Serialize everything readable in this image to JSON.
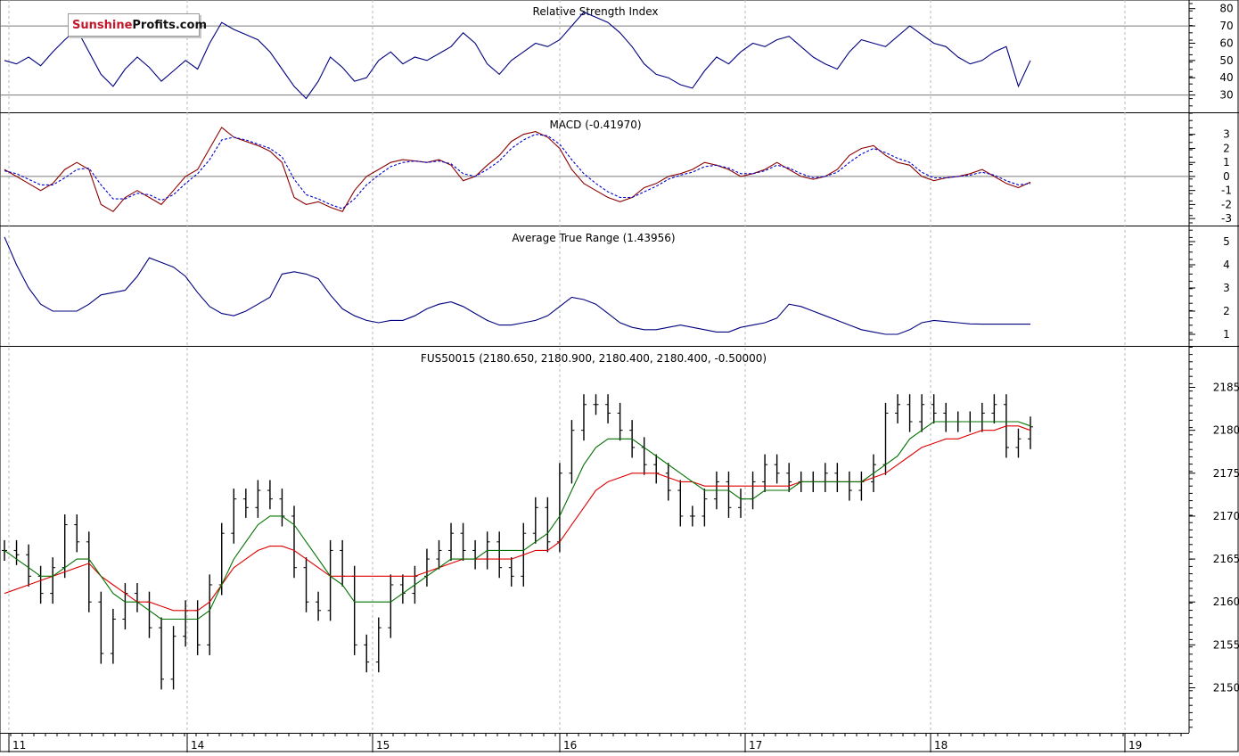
{
  "logo": {
    "part1": "Sunshine",
    "part2": "Profits.com"
  },
  "panels": {
    "rsi": {
      "title": "Relative Strength Index",
      "ticks": [
        "80",
        "70",
        "60",
        "50",
        "40",
        "30"
      ],
      "levels": [
        70,
        30
      ]
    },
    "macd": {
      "title": "MACD (-0.41970)",
      "ticks": [
        "3",
        "2",
        "1",
        "0",
        "-1",
        "-2",
        "-3"
      ]
    },
    "atr": {
      "title": "Average True Range (1.43956)",
      "ticks": [
        "5",
        "4",
        "3",
        "2",
        "1"
      ]
    },
    "price": {
      "title": "FUS50015 (2180.650, 2180.900, 2180.400, 2180.400, -0.50000)",
      "ticks": [
        "2185",
        "2180",
        "2175",
        "2170",
        "2165",
        "2160",
        "2155",
        "2150"
      ]
    }
  },
  "x_axis": {
    "labels": [
      "11",
      "14",
      "15",
      "16",
      "17",
      "18",
      "19"
    ]
  },
  "colors": {
    "rsi_line": "#00007f",
    "macd_line": "#8b0000",
    "signal_line": "#0000cd",
    "atr_line": "#00007f",
    "ma_fast": "#007000",
    "ma_slow": "#dd0000",
    "bars": "#000000"
  },
  "chart_data": {
    "type": "line",
    "x_days": [
      "11",
      "14",
      "15",
      "16",
      "17",
      "18"
    ],
    "price": {
      "type": "ohlc_bars",
      "ylim": [
        2146,
        2189
      ],
      "close": [
        2166,
        2165.5,
        2163,
        2161,
        2164,
        2169,
        2167,
        2160,
        2154,
        2158,
        2161,
        2160,
        2157,
        2151,
        2156,
        2159,
        2155,
        2162,
        2168,
        2172,
        2171,
        2173,
        2172,
        2170,
        2164,
        2160,
        2159,
        2166,
        2163,
        2155,
        2153,
        2157,
        2162,
        2161,
        2163,
        2165,
        2166,
        2168,
        2166,
        2165,
        2167,
        2164,
        2163,
        2168,
        2171,
        2167,
        2175,
        2180,
        2183,
        2183,
        2182,
        2180,
        2178,
        2176,
        2175,
        2173,
        2170,
        2170,
        2172,
        2174,
        2171,
        2172,
        2174,
        2176,
        2175,
        2174,
        2174,
        2174,
        2175,
        2174,
        2173,
        2174,
        2176,
        2182,
        2183,
        2181,
        2183,
        2182,
        2181,
        2181,
        2181,
        2182,
        2183,
        2178,
        2179,
        2180.4
      ],
      "ma_fast": [
        2166,
        2165,
        2164,
        2163,
        2163,
        2164,
        2165,
        2165,
        2163,
        2161,
        2160,
        2160,
        2159,
        2158,
        2158,
        2158,
        2158,
        2159,
        2162,
        2165,
        2167,
        2169,
        2170,
        2170,
        2169,
        2167,
        2165,
        2163,
        2162,
        2160,
        2160,
        2160,
        2160,
        2161,
        2162,
        2163,
        2164,
        2165,
        2165,
        2165,
        2166,
        2166,
        2166,
        2166,
        2167,
        2168,
        2170,
        2173,
        2176,
        2178,
        2179,
        2179,
        2179,
        2178,
        2177,
        2176,
        2175,
        2174,
        2173,
        2173,
        2173,
        2172,
        2172,
        2173,
        2173,
        2173,
        2174,
        2174,
        2174,
        2174,
        2174,
        2174,
        2175,
        2176,
        2177,
        2179,
        2180,
        2181,
        2181,
        2181,
        2181,
        2181,
        2181,
        2181,
        2181,
        2180.5
      ],
      "ma_slow": [
        2161,
        2161.5,
        2162,
        2162.5,
        2163,
        2163.5,
        2164,
        2164.5,
        2163,
        2162,
        2161,
        2160,
        2160,
        2159.5,
        2159,
        2159,
        2159,
        2160,
        2162,
        2164,
        2165,
        2166,
        2166.5,
        2166.5,
        2166,
        2165,
        2164,
        2163,
        2163,
        2163,
        2163,
        2163,
        2163,
        2163,
        2163,
        2163.5,
        2164,
        2164.5,
        2165,
        2165,
        2165,
        2165,
        2165,
        2165.5,
        2166,
        2166,
        2167,
        2169,
        2171,
        2173,
        2174,
        2174.5,
        2175,
        2175,
        2175,
        2174.5,
        2174,
        2174,
        2173.5,
        2173.5,
        2173.5,
        2173.5,
        2173.5,
        2173.5,
        2173.5,
        2173.5,
        2174,
        2174,
        2174,
        2174,
        2174,
        2174,
        2174.5,
        2175,
        2176,
        2177,
        2178,
        2178.5,
        2179,
        2179,
        2179.5,
        2180,
        2180,
        2180.5,
        2180.5,
        2180
      ]
    },
    "rsi": {
      "ylim": [
        20,
        85
      ],
      "values": [
        50,
        48,
        52,
        47,
        55,
        62,
        68,
        55,
        42,
        35,
        45,
        52,
        46,
        38,
        44,
        50,
        45,
        60,
        72,
        68,
        65,
        62,
        55,
        45,
        35,
        28,
        38,
        52,
        46,
        38,
        40,
        50,
        55,
        48,
        52,
        50,
        54,
        58,
        66,
        60,
        48,
        42,
        50,
        55,
        60,
        58,
        62,
        70,
        78,
        75,
        72,
        66,
        58,
        48,
        42,
        40,
        36,
        34,
        44,
        52,
        48,
        55,
        60,
        58,
        62,
        64,
        58,
        52,
        48,
        45,
        55,
        62,
        60,
        58,
        64,
        70,
        65,
        60,
        58,
        52,
        48,
        50,
        55,
        58,
        35,
        50
      ]
    },
    "macd": {
      "ylim": [
        -3.5,
        4
      ],
      "macd": [
        0.5,
        0,
        -0.5,
        -1,
        -0.5,
        0.5,
        1,
        0.5,
        -2,
        -2.5,
        -1.5,
        -1,
        -1.5,
        -2,
        -1,
        0,
        0.5,
        2,
        3.5,
        2.8,
        2.5,
        2.2,
        1.8,
        1,
        -1.5,
        -2,
        -1.8,
        -2.2,
        -2.5,
        -1,
        0,
        0.5,
        1,
        1.2,
        1.1,
        1,
        1.2,
        0.8,
        -0.3,
        0,
        0.8,
        1.5,
        2.5,
        3,
        3.2,
        2.8,
        2,
        0.5,
        -0.5,
        -1,
        -1.5,
        -1.8,
        -1.5,
        -0.8,
        -0.5,
        0,
        0.2,
        0.5,
        1,
        0.8,
        0.5,
        0,
        0.2,
        0.5,
        1,
        0.5,
        0,
        -0.2,
        0,
        0.5,
        1.5,
        2,
        2.2,
        1.5,
        1,
        0.8,
        0,
        -0.3,
        -0.1,
        0,
        0.2,
        0.5,
        0,
        -0.5,
        -0.8,
        -0.4
      ],
      "signal": [
        0.4,
        0.2,
        -0.2,
        -0.6,
        -0.6,
        -0.1,
        0.5,
        0.6,
        -0.6,
        -1.6,
        -1.6,
        -1.2,
        -1.3,
        -1.7,
        -1.3,
        -0.5,
        0.2,
        1.2,
        2.6,
        2.8,
        2.6,
        2.3,
        2,
        1.4,
        -0.2,
        -1.3,
        -1.6,
        -2,
        -2.3,
        -1.6,
        -0.6,
        0.1,
        0.7,
        1,
        1.1,
        1,
        1.1,
        0.9,
        0.2,
        0,
        0.5,
        1.1,
        2,
        2.6,
        3,
        2.9,
        2.3,
        1.2,
        0.2,
        -0.5,
        -1.1,
        -1.5,
        -1.5,
        -1.1,
        -0.7,
        -0.2,
        0.1,
        0.3,
        0.7,
        0.8,
        0.6,
        0.2,
        0.2,
        0.4,
        0.8,
        0.6,
        0.2,
        -0.1,
        0,
        0.3,
        1,
        1.6,
        2,
        1.7,
        1.3,
        1,
        0.3,
        -0.1,
        -0.1,
        0,
        0.1,
        0.3,
        0.1,
        -0.3,
        -0.6,
        -0.5
      ]
    },
    "atr": {
      "ylim": [
        0.5,
        5.5
      ],
      "values": [
        5.2,
        4,
        3,
        2.3,
        2,
        2,
        2,
        2.3,
        2.7,
        2.8,
        2.9,
        3.5,
        4.3,
        4.1,
        3.9,
        3.5,
        2.8,
        2.2,
        1.9,
        1.8,
        2,
        2.3,
        2.6,
        3.6,
        3.7,
        3.6,
        3.4,
        2.7,
        2.1,
        1.8,
        1.6,
        1.5,
        1.6,
        1.6,
        1.8,
        2.1,
        2.3,
        2.4,
        2.2,
        1.9,
        1.6,
        1.4,
        1.4,
        1.5,
        1.6,
        1.8,
        2.2,
        2.6,
        2.5,
        2.3,
        1.9,
        1.5,
        1.3,
        1.2,
        1.2,
        1.3,
        1.4,
        1.3,
        1.2,
        1.1,
        1.1,
        1.3,
        1.4,
        1.5,
        1.7,
        2.3,
        2.2,
        2,
        1.8,
        1.6,
        1.4,
        1.2,
        1.1,
        1.0,
        1.0,
        1.2,
        1.5,
        1.6,
        1.55,
        1.5,
        1.45,
        1.44,
        1.44,
        1.44,
        1.44,
        1.44
      ]
    }
  }
}
